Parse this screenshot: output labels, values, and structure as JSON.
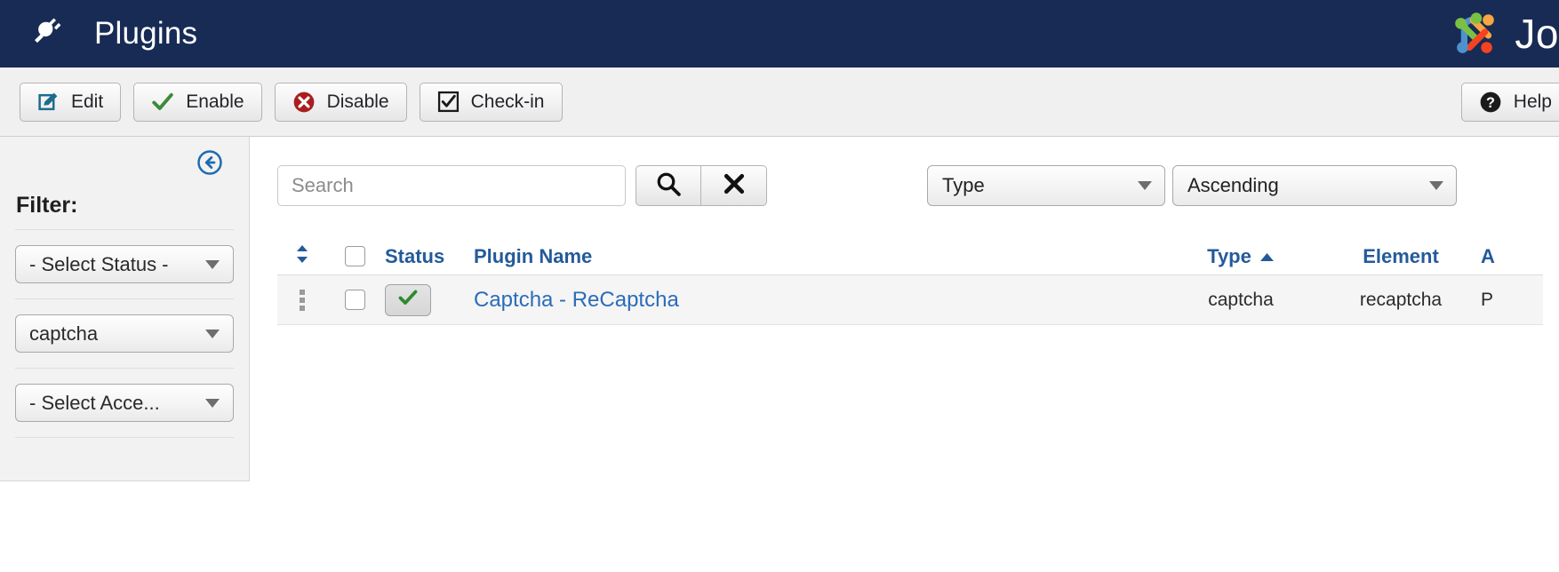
{
  "header": {
    "title": "Plugins",
    "icon": "plug-icon",
    "brand_text": "Joo",
    "brand_icon": "joomla-logo-icon",
    "background": "#172b55"
  },
  "toolbar": {
    "buttons": [
      {
        "label": "Edit",
        "icon": "edit-pencil-icon"
      },
      {
        "label": "Enable",
        "icon": "check-icon"
      },
      {
        "label": "Disable",
        "icon": "cancel-circle-icon"
      },
      {
        "label": "Check-in",
        "icon": "checkbox-icon"
      }
    ],
    "help": {
      "label": "Help",
      "icon": "question-circle-icon"
    }
  },
  "sidebar": {
    "collapse_icon": "arrow-left-circle-icon",
    "title": "Filter:",
    "filters": [
      {
        "value": "- Select Status -"
      },
      {
        "value": "captcha"
      },
      {
        "value": "- Select Acce..."
      }
    ]
  },
  "main": {
    "search": {
      "placeholder": "Search",
      "value": "",
      "search_icon": "search-icon",
      "clear_icon": "close-x-icon"
    },
    "sort": {
      "type_value": "Type",
      "direction_value": "Ascending"
    },
    "table": {
      "columns": {
        "ordering": "",
        "status": "Status",
        "name": "Plugin Name",
        "type": "Type",
        "element": "Element",
        "access": "A"
      },
      "sort_indicator": "sort-ascending-icon",
      "ordering_icon": "sort-updown-icon",
      "rows": [
        {
          "drag_handle": "drag-handle-icon",
          "selected": false,
          "status": "enabled",
          "status_icon": "check-icon",
          "name": "Captcha - ReCaptcha",
          "type": "captcha",
          "element": "recaptcha",
          "access": "P"
        }
      ]
    }
  },
  "colors": {
    "header_bg": "#172b55",
    "link": "#2b6cb8",
    "header_link": "#245a9a",
    "enable_green": "#3a8a3a",
    "disable_red": "#a81f1f",
    "edit_teal": "#1b6d8c"
  }
}
